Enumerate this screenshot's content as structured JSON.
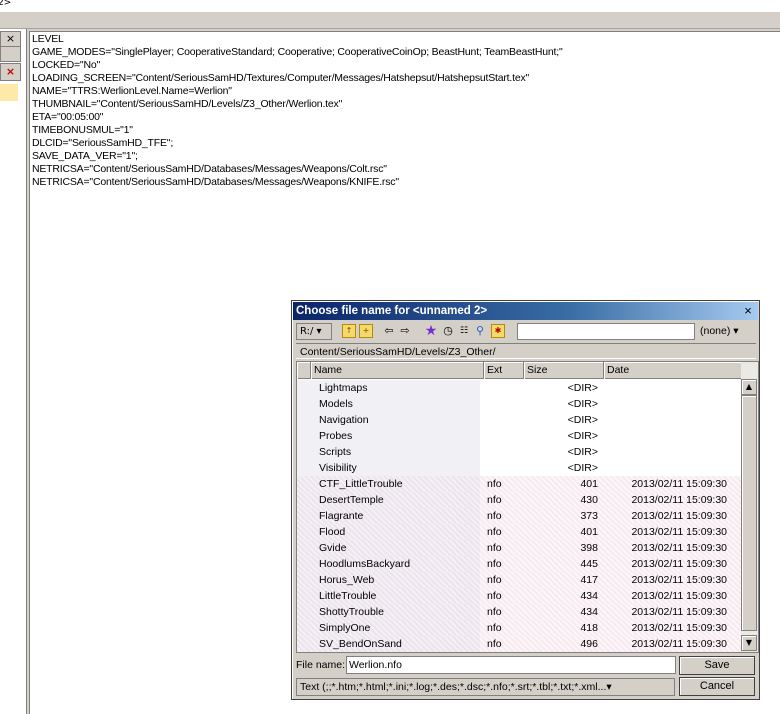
{
  "window": {
    "title_fragment": "2>"
  },
  "side_panel": {
    "close_glyph": "×",
    "remove_glyph": "×"
  },
  "editor": {
    "lines": [
      "LEVEL",
      "GAME_MODES=\"SinglePlayer; CooperativeStandard; Cooperative; CooperativeCoinOp; BeastHunt; TeamBeastHunt;\"",
      "LOCKED=\"No\"",
      "LOADING_SCREEN=\"Content/SeriousSamHD/Textures/Computer/Messages/Hatshepsut/HatshepsutStart.tex\"",
      "NAME=\"TTRS:WerlionLevel.Name=Werlion\"",
      "THUMBNAIL=\"Content/SeriousSamHD/Levels/Z3_Other/Werlion.tex\"",
      "ETA=\"00:05:00\"",
      "TIMEBONUSMUL=\"1\"",
      "DLCID=\"SeriousSamHD_TFE\";",
      "SAVE_DATA_VER=\"1\";",
      "NETRICSA=\"Content/SeriousSamHD/Databases/Messages/Weapons/Colt.rsc\"",
      "NETRICSA=\"Content/SeriousSamHD/Databases/Messages/Weapons/KNIFE.rsc\""
    ]
  },
  "dialog": {
    "title": "Choose file name for <unnamed 2>",
    "close_glyph": "×",
    "drive": "R:/ ▾",
    "filter_value": "",
    "filter_select": "(none)  ▾",
    "path": "Content/SeriousSamHD/Levels/Z3_Other/",
    "columns": {
      "name": "Name",
      "ext": "Ext",
      "size": "Size",
      "date": "Date"
    },
    "rows": [
      {
        "type": "folder",
        "name": "Lightmaps",
        "ext": "",
        "size": "<DIR>",
        "date": ""
      },
      {
        "type": "folder",
        "name": "Models",
        "ext": "",
        "size": "<DIR>",
        "date": ""
      },
      {
        "type": "folder",
        "name": "Navigation",
        "ext": "",
        "size": "<DIR>",
        "date": ""
      },
      {
        "type": "folder",
        "name": "Probes",
        "ext": "",
        "size": "<DIR>",
        "date": ""
      },
      {
        "type": "folder",
        "name": "Scripts",
        "ext": "",
        "size": "<DIR>",
        "date": ""
      },
      {
        "type": "folder",
        "name": "Visibility",
        "ext": "",
        "size": "<DIR>",
        "date": ""
      },
      {
        "type": "file",
        "name": "CTF_LittleTrouble",
        "ext": "nfo",
        "size": "401",
        "date": "2013/02/11 15:09:30"
      },
      {
        "type": "file",
        "name": "DesertTemple",
        "ext": "nfo",
        "size": "430",
        "date": "2013/02/11 15:09:30"
      },
      {
        "type": "file",
        "name": "Flagrante",
        "ext": "nfo",
        "size": "373",
        "date": "2013/02/11 15:09:30"
      },
      {
        "type": "file",
        "name": "Flood",
        "ext": "nfo",
        "size": "401",
        "date": "2013/02/11 15:09:30"
      },
      {
        "type": "file",
        "name": "Gvide",
        "ext": "nfo",
        "size": "398",
        "date": "2013/02/11 15:09:30"
      },
      {
        "type": "file",
        "name": "HoodlumsBackyard",
        "ext": "nfo",
        "size": "445",
        "date": "2013/02/11 15:09:30"
      },
      {
        "type": "file",
        "name": "Horus_Web",
        "ext": "nfo",
        "size": "417",
        "date": "2013/02/11 15:09:30"
      },
      {
        "type": "file",
        "name": "LittleTrouble",
        "ext": "nfo",
        "size": "434",
        "date": "2013/02/11 15:09:30"
      },
      {
        "type": "file",
        "name": "ShottyTrouble",
        "ext": "nfo",
        "size": "434",
        "date": "2013/02/11 15:09:30"
      },
      {
        "type": "file",
        "name": "SimplyOne",
        "ext": "nfo",
        "size": "418",
        "date": "2013/02/11 15:09:30"
      },
      {
        "type": "file",
        "name": "SV_BendOnSand",
        "ext": "nfo",
        "size": "496",
        "date": "2013/02/11 15:09:30"
      }
    ],
    "filename_label": "File name:",
    "filename_value": "Werlion.nfo",
    "filetype": "Text (;;*.htm;*.html;*.ini;*.log;*.des;*.dsc;*.nfo;*.srt;*.tbl;*.txt;*.xml...▾",
    "save_label": "Save",
    "cancel_label": "Cancel",
    "scroll_up": "▲",
    "scroll_down": "▼"
  },
  "colors": {
    "title_bar": "#0a246a",
    "face": "#d4d0c8",
    "row_shade": "#f6eaf0",
    "folder": "#f7d86b"
  }
}
